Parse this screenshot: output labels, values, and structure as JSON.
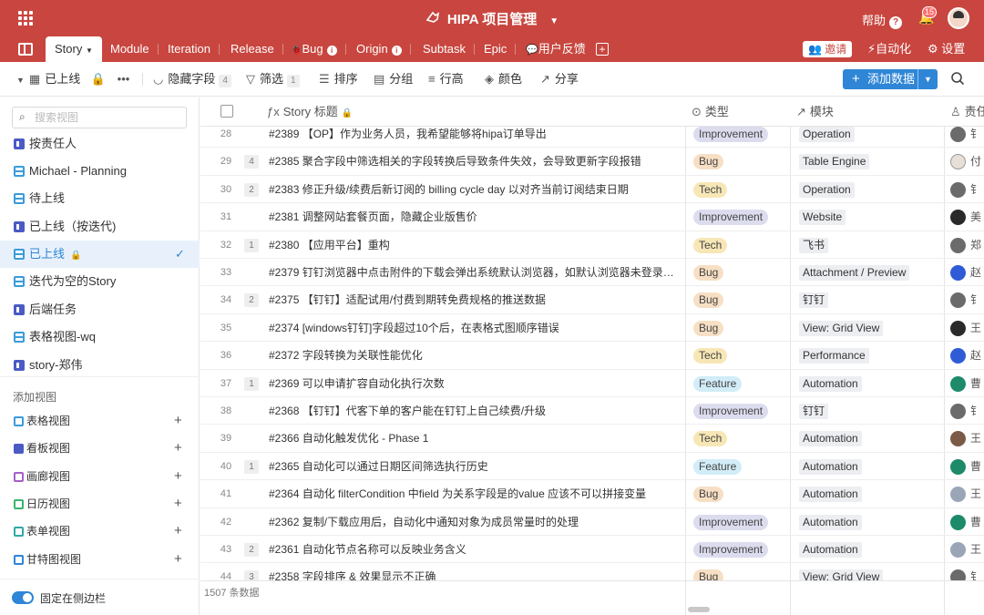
{
  "app": {
    "title": "HIPA 项目管理",
    "help_label": "帮助",
    "notification_count": "15"
  },
  "tabs": [
    {
      "label": "Story",
      "active": true
    },
    {
      "label": "Module"
    },
    {
      "label": "Iteration"
    },
    {
      "label": "Release"
    },
    {
      "label": "Bug"
    },
    {
      "label": "Origin"
    },
    {
      "label": "Subtask"
    },
    {
      "label": "Epic"
    },
    {
      "label": "用户反馈"
    }
  ],
  "tab_actions": {
    "invite": "邀请",
    "automation": "自动化",
    "settings": "设置"
  },
  "toolbar": {
    "view_name": "已上线",
    "hide_fields": "隐藏字段",
    "hide_fields_count": "4",
    "filter": "筛选",
    "filter_count": "1",
    "sort": "排序",
    "group": "分组",
    "row_height": "行高",
    "color": "颜色",
    "share": "分享",
    "add_data": "添加数据"
  },
  "sidebar": {
    "search_placeholder": "搜索视图",
    "views": [
      {
        "label": "按责任人",
        "type": "kanban"
      },
      {
        "label": "Michael - Planning",
        "type": "grid"
      },
      {
        "label": "待上线",
        "type": "grid"
      },
      {
        "label": "已上线（按迭代)",
        "type": "kanban"
      },
      {
        "label": "已上线",
        "type": "grid",
        "active": true
      },
      {
        "label": "迭代为空的Story",
        "type": "grid"
      },
      {
        "label": "后端任务",
        "type": "kanban"
      },
      {
        "label": "表格视图-wq",
        "type": "grid"
      },
      {
        "label": "story-郑伟",
        "type": "kanban"
      }
    ],
    "add_view_heading": "添加视图",
    "add_views": [
      {
        "label": "表格视图",
        "type": "c-grid"
      },
      {
        "label": "看板视图",
        "type": "c-kanban"
      },
      {
        "label": "画廊视图",
        "type": "c-gallery"
      },
      {
        "label": "日历视图",
        "type": "c-cal"
      },
      {
        "label": "表单视图",
        "type": "c-form"
      },
      {
        "label": "甘特图视图",
        "type": "c-gantt"
      }
    ],
    "pin_label": "固定在侧边栏"
  },
  "table": {
    "columns": {
      "title": "Story 标题",
      "type": "类型",
      "module": "模块",
      "owner": "责任"
    },
    "rows": [
      {
        "num": "28",
        "comments": "",
        "title": "#2389 【OP】作为业务人员，我希望能够将hipa订单导出",
        "type": "Improvement",
        "module": "Operation",
        "owner": "a1",
        "owner_trail": "钅"
      },
      {
        "num": "29",
        "comments": "4",
        "title": "#2385 聚合字段中筛选相关的字段转换后导致条件失效，会导致更新字段报错",
        "type": "Bug",
        "module": "Table Engine",
        "owner": "a2",
        "owner_trail": "付"
      },
      {
        "num": "30",
        "comments": "2",
        "title": "#2383 修正升级/续费后新订阅的 billing cycle day 以对齐当前订阅结束日期",
        "type": "Tech",
        "module": "Operation",
        "owner": "a1",
        "owner_trail": "钅"
      },
      {
        "num": "31",
        "comments": "",
        "title": "#2381 调整网站套餐页面，隐藏企业版售价",
        "type": "Improvement",
        "module": "Website",
        "owner": "a3",
        "owner_trail": "美"
      },
      {
        "num": "32",
        "comments": "1",
        "title": "#2380 【应用平台】重构",
        "type": "Tech",
        "module": "飞书",
        "owner": "a1",
        "owner_trail": "郑"
      },
      {
        "num": "33",
        "comments": "",
        "title": "#2379 钉钉浏览器中点击附件的下载会弹出系统默认浏览器，如默认浏览器未登录黑…",
        "type": "Bug",
        "module": "Attachment / Preview",
        "owner": "a4",
        "owner_trail": "赵"
      },
      {
        "num": "34",
        "comments": "2",
        "title": "#2375 【钉钉】适配试用/付费到期转免费规格的推送数据",
        "type": "Bug",
        "module": "钉钉",
        "owner": "a1",
        "owner_trail": "钅"
      },
      {
        "num": "35",
        "comments": "",
        "title": "#2374 [windows钉钉]字段超过10个后，在表格式图顺序错误",
        "type": "Bug",
        "module": "View: Grid View",
        "owner": "a3",
        "owner_trail": "王"
      },
      {
        "num": "36",
        "comments": "",
        "title": "#2372 字段转换为关联性能优化",
        "type": "Tech",
        "module": "Performance",
        "owner": "a4",
        "owner_trail": "赵"
      },
      {
        "num": "37",
        "comments": "1",
        "title": "#2369 可以申请扩容自动化执行次数",
        "type": "Feature",
        "module": "Automation",
        "owner": "a5",
        "owner_trail": "曹"
      },
      {
        "num": "38",
        "comments": "",
        "title": "#2368 【钉钉】代客下单的客户能在钉钉上自己续费/升级",
        "type": "Improvement",
        "module": "钉钉",
        "owner": "a1",
        "owner_trail": "钅"
      },
      {
        "num": "39",
        "comments": "",
        "title": "#2366 自动化触发优化 - Phase 1",
        "type": "Tech",
        "module": "Automation",
        "owner": "a6",
        "owner_trail": "王"
      },
      {
        "num": "40",
        "comments": "1",
        "title": "#2365 自动化可以通过日期区间筛选执行历史",
        "type": "Feature",
        "module": "Automation",
        "owner": "a5",
        "owner_trail": "曹"
      },
      {
        "num": "41",
        "comments": "",
        "title": "#2364 自动化 filterCondition 中field 为关系字段是的value 应该不可以拼接变量",
        "type": "Bug",
        "module": "Automation",
        "owner": "a7",
        "owner_trail": "王"
      },
      {
        "num": "42",
        "comments": "",
        "title": "#2362 复制/下载应用后，自动化中通知对象为成员常量时的处理",
        "type": "Improvement",
        "module": "Automation",
        "owner": "a5",
        "owner_trail": "曹"
      },
      {
        "num": "43",
        "comments": "2",
        "title": "#2361 自动化节点名称可以反映业务含义",
        "type": "Improvement",
        "module": "Automation",
        "owner": "a7",
        "owner_trail": "王"
      },
      {
        "num": "44",
        "comments": "3",
        "title": "#2358 字段排序 & 效果显示不正确",
        "type": "Bug",
        "module": "View: Grid View",
        "owner": "a1",
        "owner_trail": "钅"
      }
    ],
    "record_count": "1507 条数据"
  }
}
